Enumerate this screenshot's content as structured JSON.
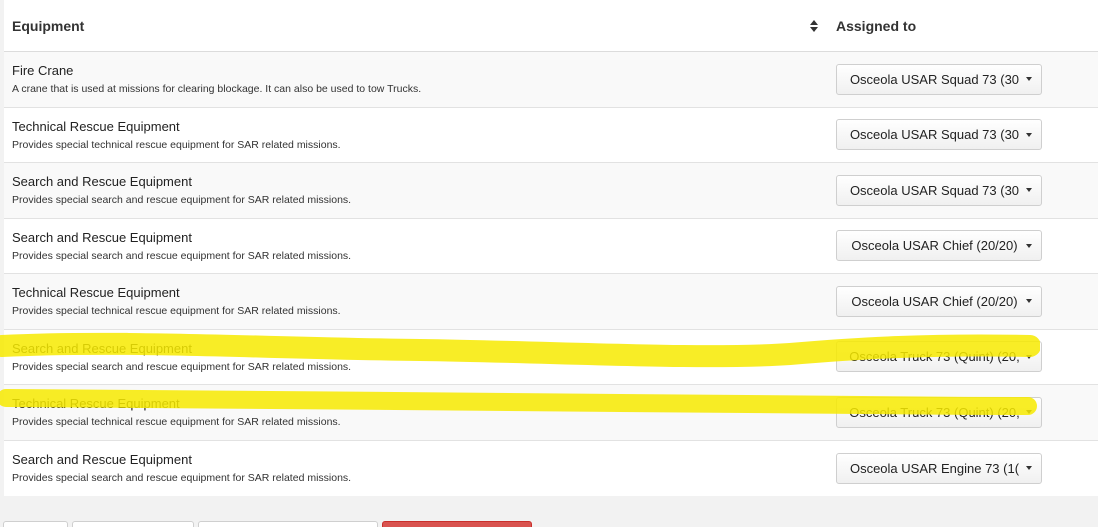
{
  "table": {
    "headers": {
      "equipment": "Equipment",
      "assigned_to": "Assigned to"
    },
    "rows": [
      {
        "name": "Fire Crane",
        "description": "A crane that is used at missions for clearing blockage. It can also be used to tow Trucks.",
        "assigned": "Osceola USAR Squad 73 (30"
      },
      {
        "name": "Technical Rescue Equipment",
        "description": "Provides special technical rescue equipment for SAR related missions.",
        "assigned": "Osceola USAR Squad 73 (30"
      },
      {
        "name": "Search and Rescue Equipment",
        "description": "Provides special search and rescue equipment for SAR related missions.",
        "assigned": "Osceola USAR Squad 73 (30"
      },
      {
        "name": "Search and Rescue Equipment",
        "description": "Provides special search and rescue equipment for SAR related missions.",
        "assigned": "Osceola USAR Chief (20/20)"
      },
      {
        "name": "Technical Rescue Equipment",
        "description": "Provides special technical rescue equipment for SAR related missions.",
        "assigned": "Osceola USAR Chief (20/20)"
      },
      {
        "name": "Search and Rescue Equipment",
        "description": "Provides special search and rescue equipment for SAR related missions.",
        "assigned": "Osceola Truck 73 (Quint) (20,"
      },
      {
        "name": "Technical Rescue Equipment",
        "description": "Provides special technical rescue equipment for SAR related missions.",
        "assigned": "Osceola Truck 73 (Quint) (20,"
      },
      {
        "name": "Search and Rescue Equipment",
        "description": "Provides special search and rescue equipment for SAR related missions.",
        "assigned": "Osceola USAR Engine 73 (1("
      }
    ]
  },
  "colors": {
    "highlight": "#f7ea00",
    "danger_button": "#d9534f"
  }
}
